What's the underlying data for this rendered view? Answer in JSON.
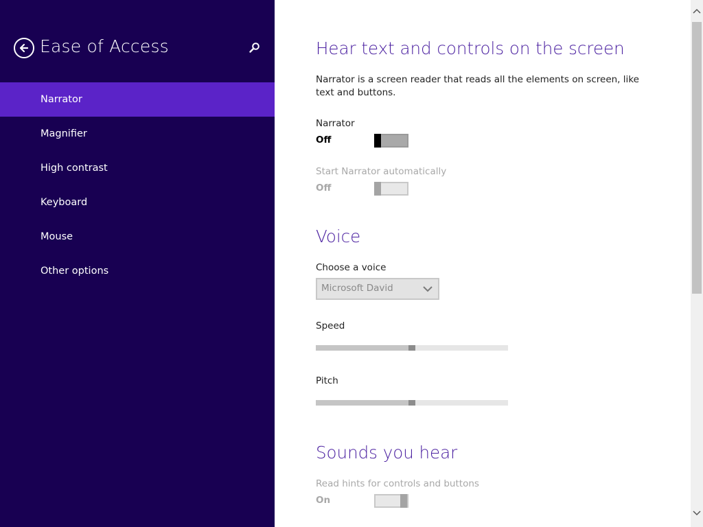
{
  "sidebar": {
    "title": "Ease of Access",
    "items": [
      {
        "label": "Narrator",
        "selected": true
      },
      {
        "label": "Magnifier",
        "selected": false
      },
      {
        "label": "High contrast",
        "selected": false
      },
      {
        "label": "Keyboard",
        "selected": false
      },
      {
        "label": "Mouse",
        "selected": false
      },
      {
        "label": "Other options",
        "selected": false
      }
    ],
    "icons": {
      "back": "back-arrow-icon",
      "search": "search-icon"
    }
  },
  "main": {
    "heading": "Hear text and controls on the screen",
    "description": "Narrator is a screen reader that reads all the elements on screen, like text and buttons.",
    "narrator": {
      "label": "Narrator",
      "state": "Off",
      "on": false,
      "enabled": true
    },
    "start_auto": {
      "label": "Start Narrator automatically",
      "state": "Off",
      "on": false,
      "enabled": false
    },
    "voice": {
      "heading": "Voice",
      "choose_label": "Choose a voice",
      "selected_voice": "Microsoft David",
      "speed_label": "Speed",
      "speed_value": 0.5,
      "pitch_label": "Pitch",
      "pitch_value": 0.5
    },
    "sounds": {
      "heading": "Sounds you hear",
      "hints": {
        "label": "Read hints for controls and buttons",
        "state": "On",
        "on": true,
        "enabled": false
      }
    }
  },
  "colors": {
    "sidebar_bg": "#180052",
    "selected_item": "#5b23c8",
    "heading": "#4a1fa0",
    "toggle_thumb": "#000000"
  }
}
